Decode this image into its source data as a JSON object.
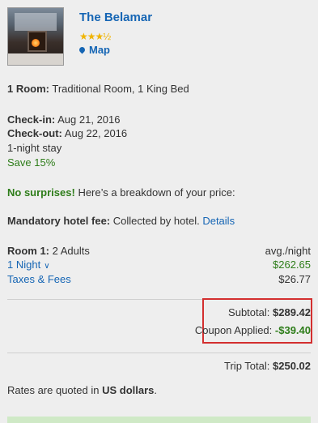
{
  "hotel": {
    "name": "The Belamar",
    "stars": "★★★½",
    "map_label": "Map"
  },
  "room_line": {
    "label": "1 Room:",
    "value": "Traditional Room, 1 King Bed"
  },
  "stay": {
    "checkin_label": "Check-in:",
    "checkin_value": "Aug 21, 2016",
    "checkout_label": "Check-out:",
    "checkout_value": "Aug 22, 2016",
    "nights": "1-night stay",
    "savings": "Save 15%"
  },
  "no_surprises": {
    "label": "No surprises!",
    "text": "Here’s a breakdown of your price:"
  },
  "fee": {
    "label": "Mandatory hotel fee:",
    "text": "Collected by hotel.",
    "details": "Details"
  },
  "price_table": {
    "room_label": "Room 1:",
    "room_value": "2 Adults",
    "avg_label": "avg./night",
    "night_label": "1 Night",
    "night_price": "$262.65",
    "taxes_label": "Taxes & Fees",
    "taxes_value": "$26.77"
  },
  "subtotal": {
    "label": "Subtotal:",
    "value": "$289.42",
    "coupon_label": "Coupon Applied:",
    "coupon_value": "-$39.40"
  },
  "total": {
    "label": "Trip Total:",
    "value": "$250.02"
  },
  "currency_note": {
    "prefix": "Rates are quoted in",
    "currency": "US dollars",
    "suffix": "."
  }
}
